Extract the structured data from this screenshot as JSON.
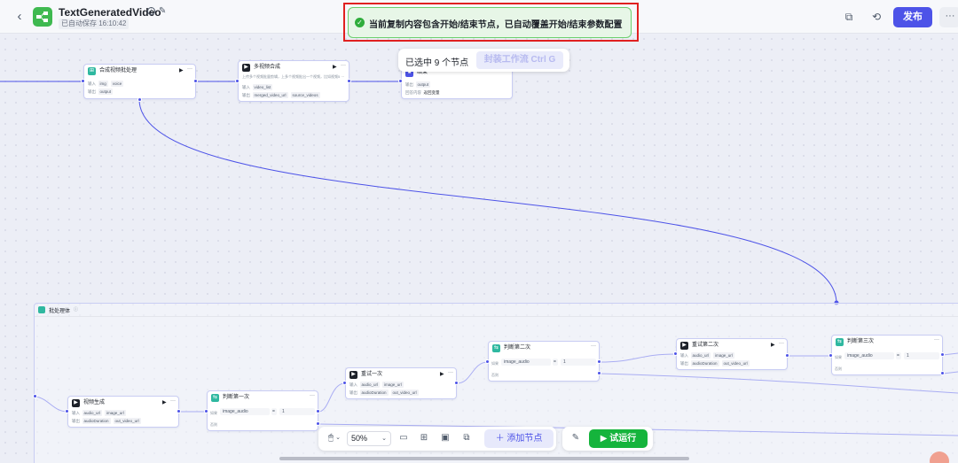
{
  "header": {
    "title": "TextGeneratedVideo",
    "autosave": "已自动保存 16:10:42",
    "publish": "发布",
    "more": "···"
  },
  "toast": {
    "message": "当前复制内容包含开始/结束节点，已自动覆盖开始/结束参数配置"
  },
  "selection": {
    "count_text": "已选中 9 个节点",
    "copy_label": "封装工作流 Ctrl G"
  },
  "nodes": {
    "synth": {
      "title": "合成视频批处理",
      "in_label": "输入",
      "in_tags": [
        "img",
        "voice"
      ],
      "out_label": "输出",
      "out_tags": [
        "output"
      ]
    },
    "multi": {
      "title": "多视频合成",
      "desc": "上传多个视频批量剪辑，上多个视频批出一个视频，比如视频5 ···",
      "in_label": "输入",
      "in_tags": [
        "video_list"
      ],
      "out_label": "输出",
      "out_tags": [
        "merged_video_url",
        "source_videos"
      ]
    },
    "end": {
      "title": "结束",
      "out_label": "输出",
      "out_tags": [
        "output"
      ],
      "mode_label": "回答内容",
      "mode_value": "返回变量"
    },
    "video1": {
      "title": "视频生成",
      "in_label": "输入",
      "in_tags": [
        "audio_url",
        "image_url"
      ],
      "out_label": "输出",
      "out_tags": [
        "audioDuration",
        "out_video_url"
      ]
    },
    "judge1": {
      "title": "判断第一次",
      "cond_label": "如果",
      "cond_var": "image_audio",
      "cond_op": "=",
      "cond_val": "1",
      "else_label": "否则"
    },
    "retry1": {
      "title": "重试一次",
      "in_label": "输入",
      "in_tags": [
        "audio_url",
        "image_url"
      ],
      "out_label": "输出",
      "out_tags": [
        "audioDuration",
        "out_video_url"
      ]
    },
    "judge2": {
      "title": "判断第二次",
      "cond_label": "如果",
      "cond_var": "image_audio",
      "cond_op": "=",
      "cond_val": "1",
      "else_label": "否则"
    },
    "retry2": {
      "title": "重试第二次",
      "in_label": "输入",
      "in_tags": [
        "audio_url",
        "image_url"
      ],
      "out_label": "输出",
      "out_tags": [
        "audioDuration",
        "out_video_url"
      ]
    },
    "judge3": {
      "title": "判断第三次",
      "cond_label": "如果",
      "cond_var": "image_audio",
      "cond_op": "=",
      "cond_val": "1",
      "else_label": "否则"
    }
  },
  "group": {
    "title": "批处理体"
  },
  "bottom_toolbar": {
    "zoom": "50%",
    "add_node": "添加节点",
    "test_run": "试运行"
  },
  "colors": {
    "accent": "#4d53e8",
    "success": "#15b43c",
    "toast_border": "#e02020"
  }
}
